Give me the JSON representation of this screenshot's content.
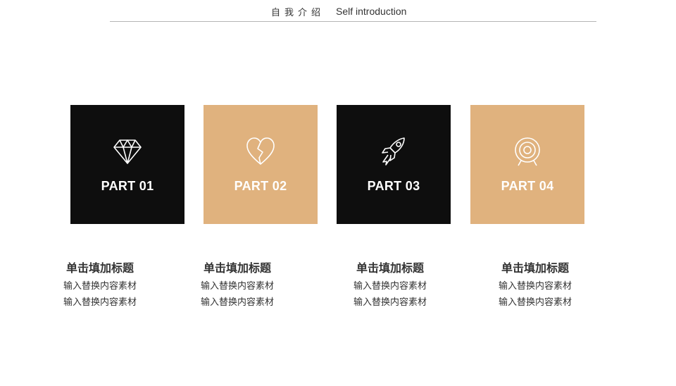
{
  "header": {
    "title_cn": "自我介绍",
    "title_en": "Self introduction"
  },
  "colors": {
    "dark": "#0e0e0e",
    "tan": "#e0b27e",
    "icon_stroke": "#ffffff",
    "rule": "#b5b5b5"
  },
  "cards": [
    {
      "label": "PART 01",
      "icon": "diamond-icon",
      "style": "dark"
    },
    {
      "label": "PART 02",
      "icon": "broken-heart-icon",
      "style": "tan"
    },
    {
      "label": "PART 03",
      "icon": "rocket-icon",
      "style": "dark"
    },
    {
      "label": "PART 04",
      "icon": "target-icon",
      "style": "tan"
    }
  ],
  "captions": [
    {
      "title": "单击填加标题",
      "line1": "输入替换内容素材",
      "line2": "输入替换内容素材"
    },
    {
      "title": "单击填加标题",
      "line1": "输入替换内容素材",
      "line2": "输入替换内容素材"
    },
    {
      "title": "单击填加标题",
      "line1": "输入替换内容素材",
      "line2": "输入替换内容素材"
    },
    {
      "title": "单击填加标题",
      "line1": "输入替换内容素材",
      "line2": "输入替换内容素材"
    }
  ]
}
